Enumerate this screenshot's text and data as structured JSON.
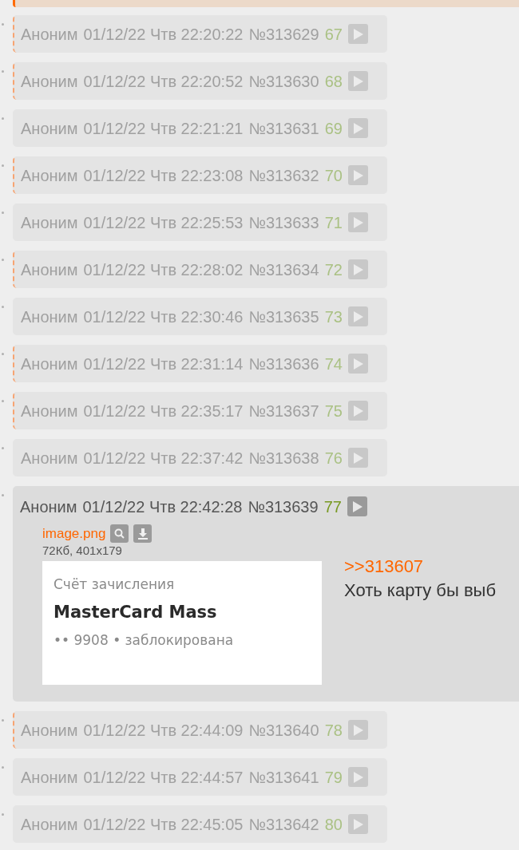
{
  "posts": [
    {
      "kind": "collapsed",
      "marked": true,
      "name": "Аноним",
      "date": "01/12/22 Чтв 22:20:22",
      "number": "№313629",
      "counter": "67"
    },
    {
      "kind": "collapsed",
      "marked": true,
      "name": "Аноним",
      "date": "01/12/22 Чтв 22:20:52",
      "number": "№313630",
      "counter": "68"
    },
    {
      "kind": "collapsed",
      "marked": false,
      "name": "Аноним",
      "date": "01/12/22 Чтв 22:21:21",
      "number": "№313631",
      "counter": "69"
    },
    {
      "kind": "collapsed",
      "marked": true,
      "name": "Аноним",
      "date": "01/12/22 Чтв 22:23:08",
      "number": "№313632",
      "counter": "70"
    },
    {
      "kind": "collapsed",
      "marked": false,
      "name": "Аноним",
      "date": "01/12/22 Чтв 22:25:53",
      "number": "№313633",
      "counter": "71"
    },
    {
      "kind": "collapsed",
      "marked": true,
      "name": "Аноним",
      "date": "01/12/22 Чтв 22:28:02",
      "number": "№313634",
      "counter": "72"
    },
    {
      "kind": "collapsed",
      "marked": false,
      "name": "Аноним",
      "date": "01/12/22 Чтв 22:30:46",
      "number": "№313635",
      "counter": "73"
    },
    {
      "kind": "collapsed",
      "marked": true,
      "name": "Аноним",
      "date": "01/12/22 Чтв 22:31:14",
      "number": "№313636",
      "counter": "74"
    },
    {
      "kind": "collapsed",
      "marked": true,
      "name": "Аноним",
      "date": "01/12/22 Чтв 22:35:17",
      "number": "№313637",
      "counter": "75"
    },
    {
      "kind": "collapsed",
      "marked": false,
      "name": "Аноним",
      "date": "01/12/22 Чтв 22:37:42",
      "number": "№313638",
      "counter": "76"
    },
    {
      "kind": "expanded",
      "marked": false,
      "name": "Аноним",
      "date": "01/12/22 Чтв 22:42:28",
      "number": "№313639",
      "counter": "77",
      "file": {
        "name": "image.png",
        "info": "72Кб, 401x179",
        "preview_lines": [
          "Счёт зачисления",
          "MasterCard Mass",
          "•• 9908 • заблокирована"
        ]
      },
      "reply_link": ">>313607",
      "text": "Хоть карту бы выб"
    },
    {
      "kind": "collapsed",
      "marked": true,
      "name": "Аноним",
      "date": "01/12/22 Чтв 22:44:09",
      "number": "№313640",
      "counter": "78"
    },
    {
      "kind": "collapsed",
      "marked": false,
      "name": "Аноним",
      "date": "01/12/22 Чтв 22:44:57",
      "number": "№313641",
      "counter": "79"
    },
    {
      "kind": "collapsed",
      "marked": false,
      "name": "Аноним",
      "date": "01/12/22 Чтв 22:45:05",
      "number": "№313642",
      "counter": "80"
    }
  ]
}
